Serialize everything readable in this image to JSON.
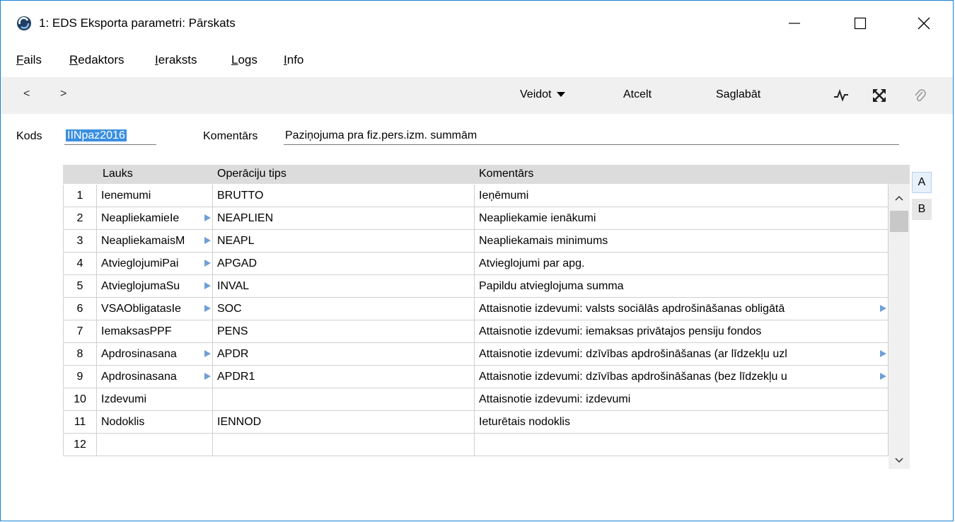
{
  "window": {
    "title": "1: EDS Eksporta parametri: Pārskats"
  },
  "menu": [
    {
      "first": "F",
      "rest": "ails"
    },
    {
      "first": "R",
      "rest": "edaktors"
    },
    {
      "first": "I",
      "rest": "eraksts"
    },
    {
      "first": "L",
      "rest": "ogs"
    },
    {
      "first": "I",
      "rest": "nfo"
    }
  ],
  "toolbar": {
    "back": "<",
    "forward": ">",
    "create_label": "Veidot",
    "cancel_label": "Atcelt",
    "save_label": "Saglabāt"
  },
  "form": {
    "code_label": "Kods",
    "code_value": "IINpaz2016",
    "comment_label": "Komentārs",
    "comment_value": "Paziņojuma pra fiz.pers.izm. summām"
  },
  "grid": {
    "columns": [
      "Lauks",
      "Operāciju tips",
      "Komentārs"
    ],
    "rows": [
      {
        "num": "1",
        "field": "Ienemumi",
        "op": "BRUTTO",
        "comment": "Ieņēmumi",
        "field_trunc": false,
        "comment_trunc": false
      },
      {
        "num": "2",
        "field": "NeapliekamieIe",
        "op": "NEAPLIEN",
        "comment": "Neapliekamie ienākumi",
        "field_trunc": true,
        "comment_trunc": false
      },
      {
        "num": "3",
        "field": "NeapliekamaisM",
        "op": "NEAPL",
        "comment": "Neapliekamais minimums",
        "field_trunc": true,
        "comment_trunc": false
      },
      {
        "num": "4",
        "field": "AtvieglojumiPai",
        "op": "APGAD",
        "comment": "Atvieglojumi par apg.",
        "field_trunc": true,
        "comment_trunc": false
      },
      {
        "num": "5",
        "field": "AtvieglojumaSu",
        "op": "INVAL",
        "comment": "Papildu atvieglojuma summa",
        "field_trunc": true,
        "comment_trunc": false
      },
      {
        "num": "6",
        "field": "VSAObligatasIe",
        "op": "SOC",
        "comment": "Attaisnotie izdevumi: valsts sociālās apdrošināšanas obligātā",
        "field_trunc": true,
        "comment_trunc": true
      },
      {
        "num": "7",
        "field": "IemaksasPPF",
        "op": "PENS",
        "comment": "Attaisnotie izdevumi: iemaksas privātajos pensiju fondos",
        "field_trunc": false,
        "comment_trunc": false
      },
      {
        "num": "8",
        "field": "Apdrosinasana",
        "op": "APDR",
        "comment": "Attaisnotie izdevumi: dzīvības apdrošināšanas (ar līdzekļu uzl",
        "field_trunc": true,
        "comment_trunc": true
      },
      {
        "num": "9",
        "field": "Apdrosinasana",
        "op": "APDR1",
        "comment": "Attaisnotie izdevumi: dzīvības apdrošināšanas (bez līdzekļu u",
        "field_trunc": true,
        "comment_trunc": true
      },
      {
        "num": "10",
        "field": "Izdevumi",
        "op": "",
        "comment": "Attaisnotie izdevumi: izdevumi",
        "field_trunc": false,
        "comment_trunc": false
      },
      {
        "num": "11",
        "field": "Nodoklis",
        "op": "IENNOD",
        "comment": "Ieturētais nodoklis",
        "field_trunc": false,
        "comment_trunc": false
      },
      {
        "num": "12",
        "field": "",
        "op": "",
        "comment": "",
        "field_trunc": false,
        "comment_trunc": false
      }
    ]
  },
  "page_tabs": [
    "A",
    "B"
  ]
}
